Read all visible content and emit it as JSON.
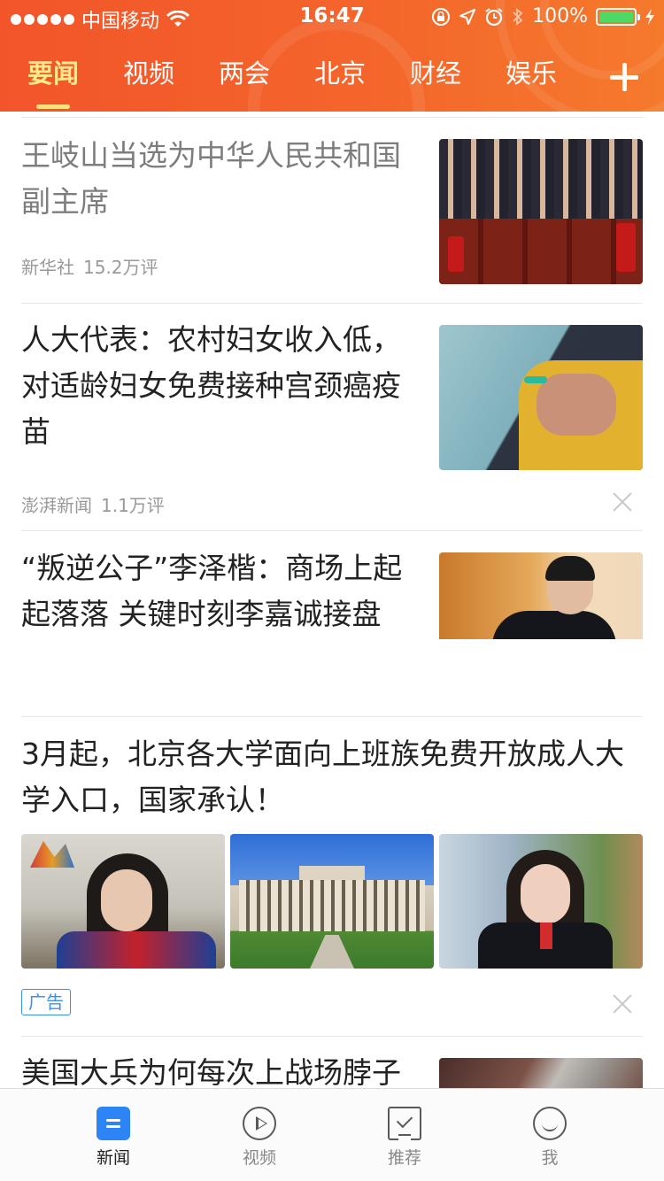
{
  "status_bar": {
    "carrier": "中国移动",
    "time": "16:47",
    "battery": "100%"
  },
  "channel_tabs": [
    {
      "label": "要闻",
      "active": true
    },
    {
      "label": "视频",
      "active": false
    },
    {
      "label": "两会",
      "active": false
    },
    {
      "label": "北京",
      "active": false
    },
    {
      "label": "财经",
      "active": false
    },
    {
      "label": "娱乐",
      "active": false
    }
  ],
  "feed": [
    {
      "title": "王岐山当选为中华人民共和国副主席",
      "title_lines": [
        "王岐山当选为中华人民共和国",
        "副主席"
      ],
      "source": "新华社",
      "comments": "15.2万评",
      "read": true,
      "thumbnail": "congress-hall-photo"
    },
    {
      "title": "人大代表：农村妇女收入低，对适龄妇女免费接种宫颈癌疫苗",
      "title_lines": [
        "人大代表：农村妇女收入低，",
        "对适龄妇女免费接种宫颈癌疫",
        "苗"
      ],
      "source": "澎湃新闻",
      "comments": "1.1万评",
      "read": false,
      "thumbnail": "vaccination-photo"
    },
    {
      "title": "“叛逆公子”李泽楷：商场上起起落落 关键时刻李嘉诚接盘",
      "title_lines": [
        "“叛逆公子”李泽楷：商场上起",
        "起落落 关键时刻李嘉诚接盘"
      ],
      "read": false,
      "thumbnail": "portrait-photo"
    },
    {
      "title": "3月起，北京各大学面向上班族免费开放成人大学入口，国家承认！",
      "title_lines": [
        "3月起，北京各大学面向上班族免费开放成人大",
        "学入口，国家承认！"
      ],
      "badge": "广告",
      "read": false,
      "thumbnails": [
        "student-selfie-photo",
        "campus-building-photo",
        "graduate-photo"
      ]
    },
    {
      "title": "美国大兵为何每次上战场脖子",
      "title_lines": [
        "美国大兵为何每次上战场脖子"
      ],
      "read": false,
      "thumbnail": "dog-tag-photo"
    }
  ],
  "bottom_nav": [
    {
      "label": "新闻",
      "icon": "news-icon",
      "active": true
    },
    {
      "label": "视频",
      "icon": "play-icon",
      "active": false
    },
    {
      "label": "推荐",
      "icon": "recommend-icon",
      "active": false
    },
    {
      "label": "我",
      "icon": "smiley-icon",
      "active": false
    }
  ],
  "colors": {
    "header": "#f4612b",
    "active_tab": "#ffe98a",
    "accent_blue": "#2d84f4",
    "read_title": "#7d7d7d",
    "meta": "#999999"
  }
}
